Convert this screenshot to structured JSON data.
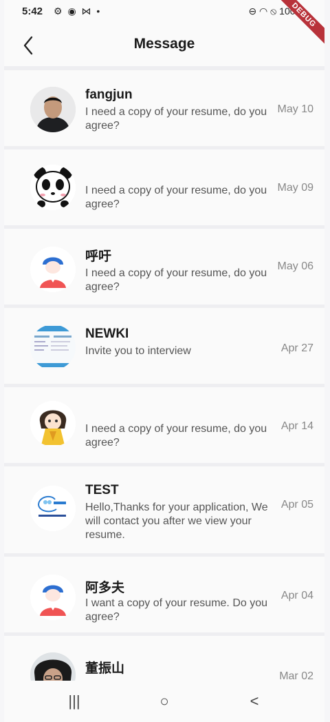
{
  "status_bar": {
    "time": "5:42",
    "left_icons": "⚙ ◉ ⋈ •",
    "right_icons": "⊖ ◠ ⦸ 100%",
    "debug_label": "DEBUG"
  },
  "app_bar": {
    "title": "Message"
  },
  "messages": [
    {
      "name": "fangjun",
      "text": "I need a copy of your resume, do you agree?",
      "date": "May 10"
    },
    {
      "name": "",
      "text": "I need a copy of your resume, do you agree?",
      "date": "May 09"
    },
    {
      "name": "呼吁",
      "text": "I need a copy of your resume, do you agree?",
      "date": "May 06"
    },
    {
      "name": "NEWKI",
      "text": "Invite you to interview",
      "date": "Apr 27"
    },
    {
      "name": "",
      "text": "I need a copy of your resume, do you agree?",
      "date": "Apr 14"
    },
    {
      "name": "TEST",
      "text": "Hello,Thanks for your application, We will contact you after we view your resume.",
      "date": "Apr 05"
    },
    {
      "name": "阿多夫",
      "text": "I want a copy of your resume. Do you agree?",
      "date": "Apr 04"
    },
    {
      "name": "董振山",
      "text": "",
      "date": "Mar 02"
    }
  ],
  "nav": {
    "recents_icon": "|||",
    "home_icon": "○",
    "back_icon": "<"
  }
}
